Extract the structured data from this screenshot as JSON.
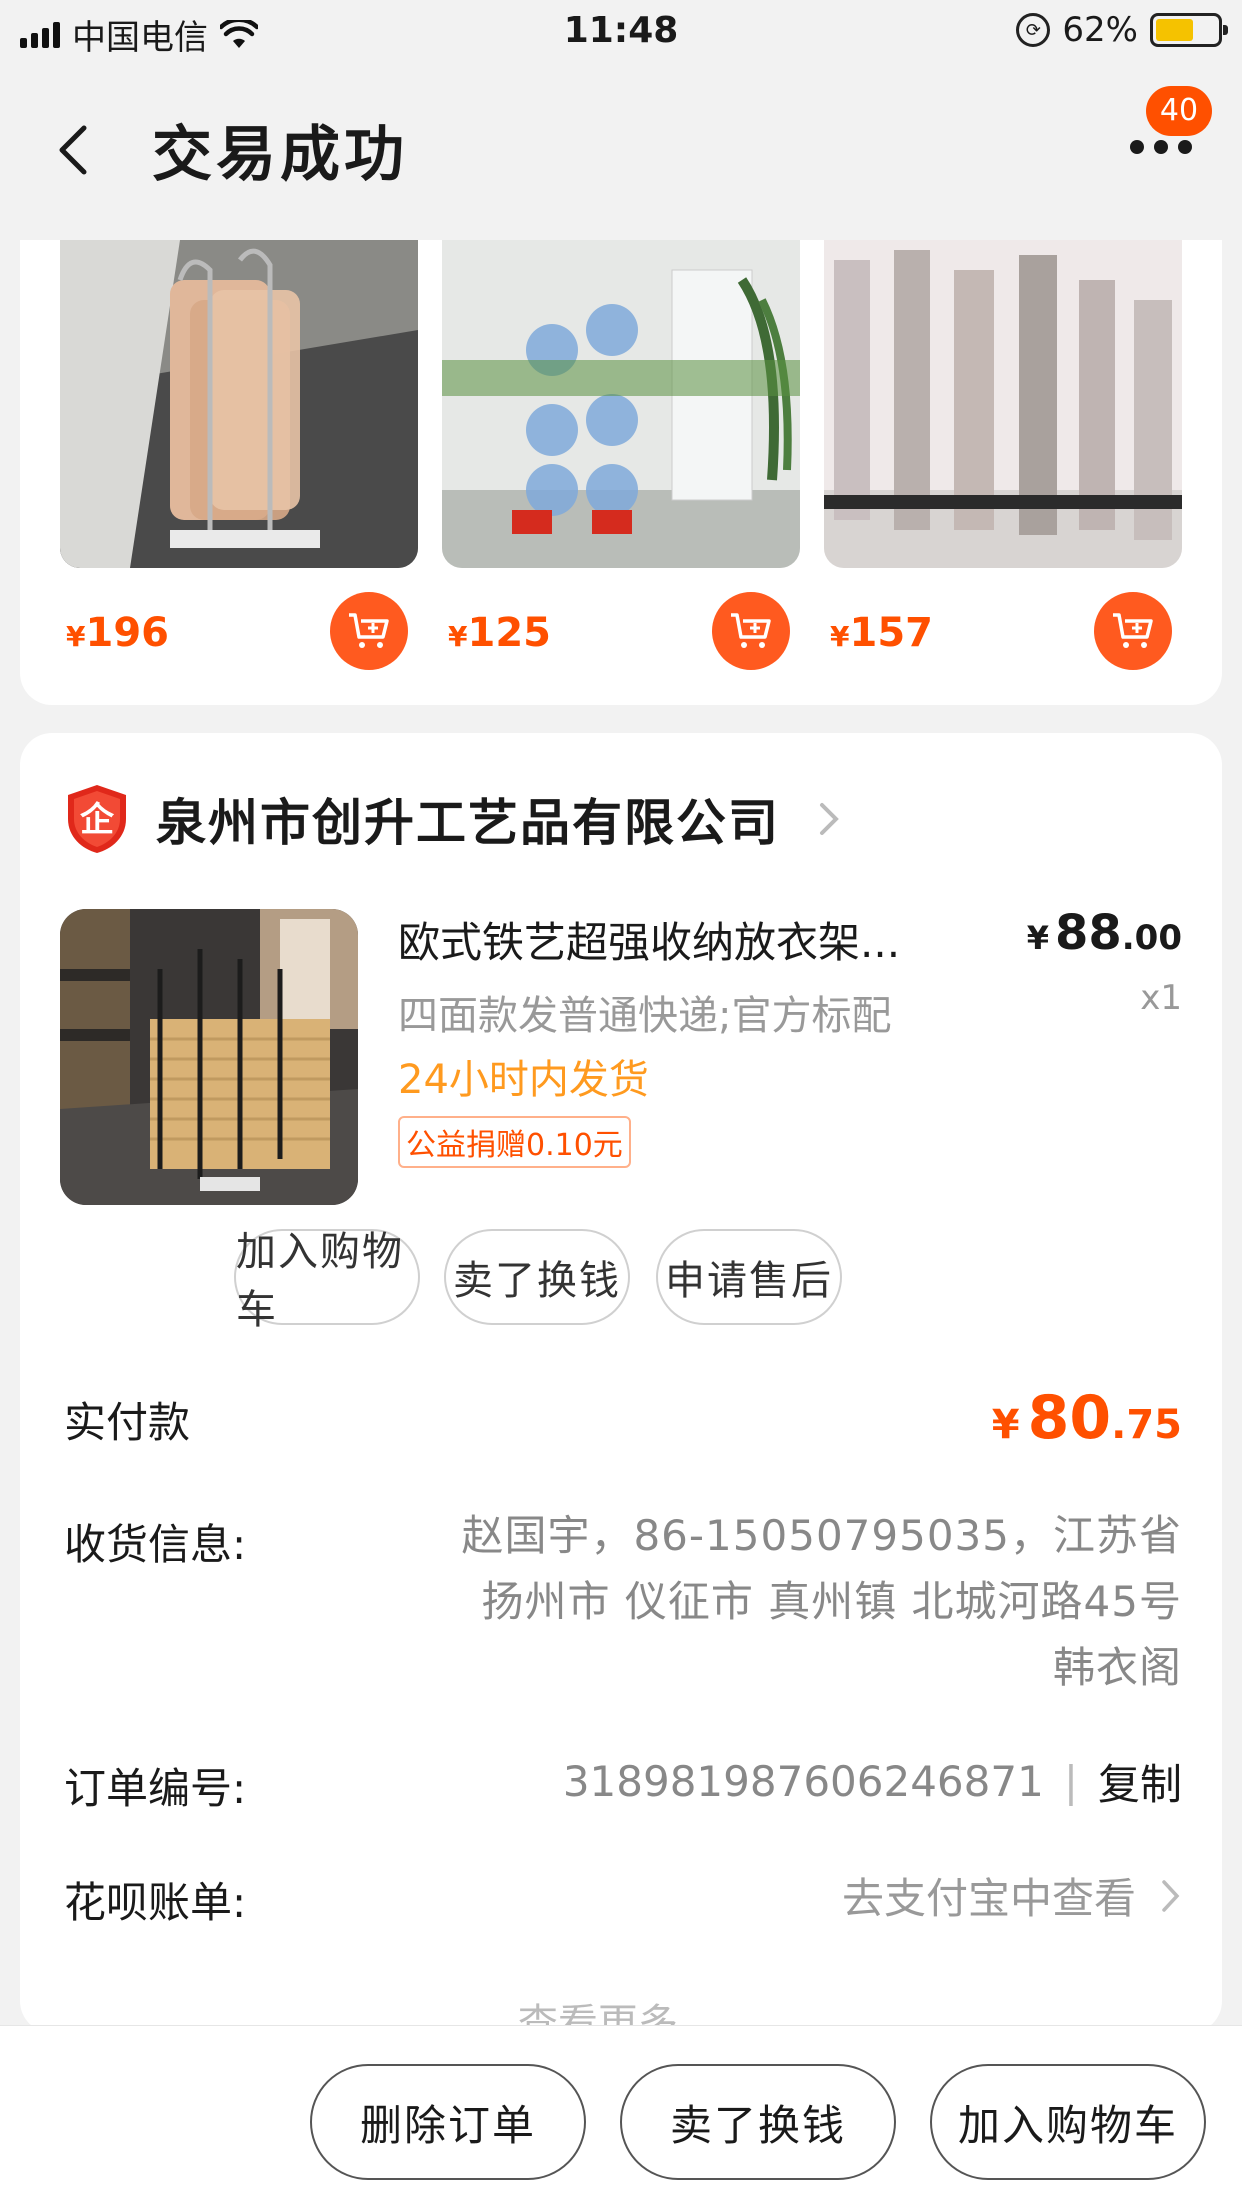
{
  "status_bar": {
    "carrier": "中国电信",
    "time": "11:48",
    "battery_percent": "62%",
    "battery_level": 0.62
  },
  "nav": {
    "title": "交易成功",
    "badge_count": "40"
  },
  "recommendations": [
    {
      "currency": "¥",
      "price": "196"
    },
    {
      "currency": "¥",
      "price": "125"
    },
    {
      "currency": "¥",
      "price": "157"
    }
  ],
  "order": {
    "shop_name": "泉州市创升工艺品有限公司",
    "product": {
      "title": "欧式铁艺超强收纳放衣架...",
      "spec": "四面款发普通快递;官方标配",
      "shipping": "24小时内发货",
      "charity_tag": "公益捐赠0.10元",
      "price_symbol": "¥",
      "price_int": "88",
      "price_dec": ".00",
      "quantity": "x1"
    },
    "item_actions": {
      "add_to_cart": "加入购物车",
      "resell": "卖了换钱",
      "after_sale": "申请售后"
    },
    "paid": {
      "label": "实付款",
      "symbol": "¥",
      "int": "80",
      "dec": ".75"
    },
    "address": {
      "label": "收货信息:",
      "line1": "赵国宇，86-15050795035，江苏省",
      "line2": "扬州市 仪征市 真州镇 北城河路45号",
      "line3": "韩衣阁"
    },
    "order_number": {
      "label": "订单编号:",
      "value": "3189819876062468​71",
      "sep": "|",
      "copy": "复制"
    },
    "huabei": {
      "label": "花呗账单:",
      "link": "去支付宝中查看"
    },
    "view_more": "查看更多"
  },
  "bottom_bar": {
    "delete": "删除订单",
    "resell": "卖了换钱",
    "add_to_cart": "加入购物车"
  },
  "colors": {
    "accent": "#ff5000",
    "shipping": "#ff9a1f",
    "muted": "#999999"
  }
}
